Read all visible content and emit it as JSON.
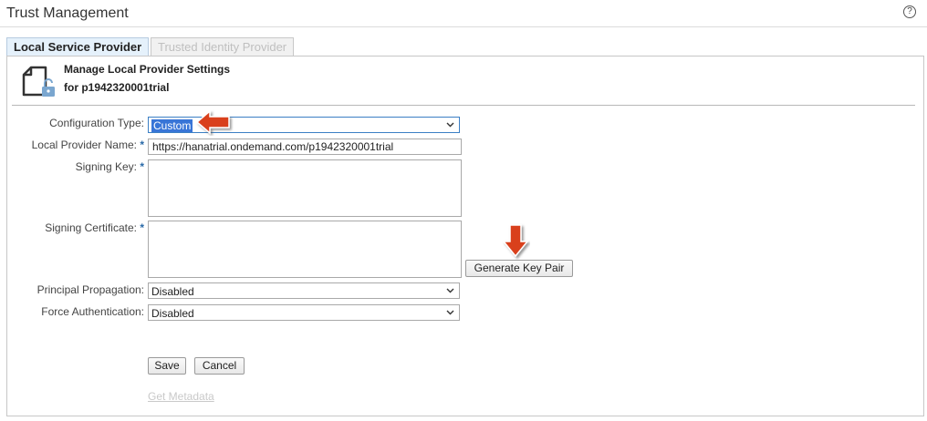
{
  "header": {
    "title": "Trust Management",
    "help_glyph": "?"
  },
  "tabs": [
    {
      "label": "Local Service Provider",
      "active": true
    },
    {
      "label": "Trusted Identity Provider",
      "active": false
    }
  ],
  "panel": {
    "heading_line1": "Manage Local Provider Settings",
    "heading_line2": "for p1942320001trial",
    "icon": "document-lock-icon"
  },
  "form": {
    "required_marker": "*",
    "configuration_type": {
      "label": "Configuration Type:",
      "value": "Custom"
    },
    "local_provider_name": {
      "label": "Local Provider Name:",
      "value": "https://hanatrial.ondemand.com/p1942320001trial"
    },
    "signing_key": {
      "label": "Signing Key:",
      "value": ""
    },
    "signing_certificate": {
      "label": "Signing Certificate:",
      "value": ""
    },
    "generate_key_pair": "Generate Key Pair",
    "principal_propagation": {
      "label": "Principal Propagation:",
      "value": "Disabled"
    },
    "force_authentication": {
      "label": "Force Authentication:",
      "value": "Disabled"
    },
    "save": "Save",
    "cancel": "Cancel",
    "get_metadata": "Get Metadata"
  },
  "colors": {
    "accent": "#3875d7",
    "annotation_arrow": "#d9401e",
    "required": "#2a6aa8"
  }
}
